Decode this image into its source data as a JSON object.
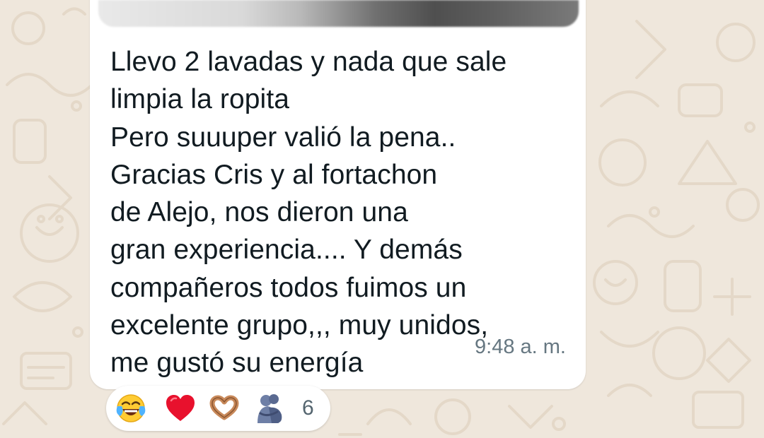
{
  "message": {
    "lines": [
      "Llevo 2 lavadas y nada que sale",
      "limpia la ropita",
      "Pero suuuper valió la pena..",
      "Gracias Cris y al fortachon",
      "de Alejo, nos dieron una",
      "gran experiencia.... Y demás",
      "compañeros todos fuimos un",
      "excelente grupo,,, muy unidos,",
      "me gustó su energía"
    ],
    "time": "9:48 a. m."
  },
  "reactions": {
    "items": [
      "face-with-tears-of-joy-icon",
      "red-heart-icon",
      "heart-hands-icon",
      "people-hugging-icon"
    ],
    "count": "6"
  },
  "colors": {
    "wallpaper": "#efe7dc",
    "doodle": "#e4d8c8",
    "bubble": "#ffffff",
    "text": "#111b21",
    "meta": "#667781",
    "heart": "#e8112d"
  }
}
